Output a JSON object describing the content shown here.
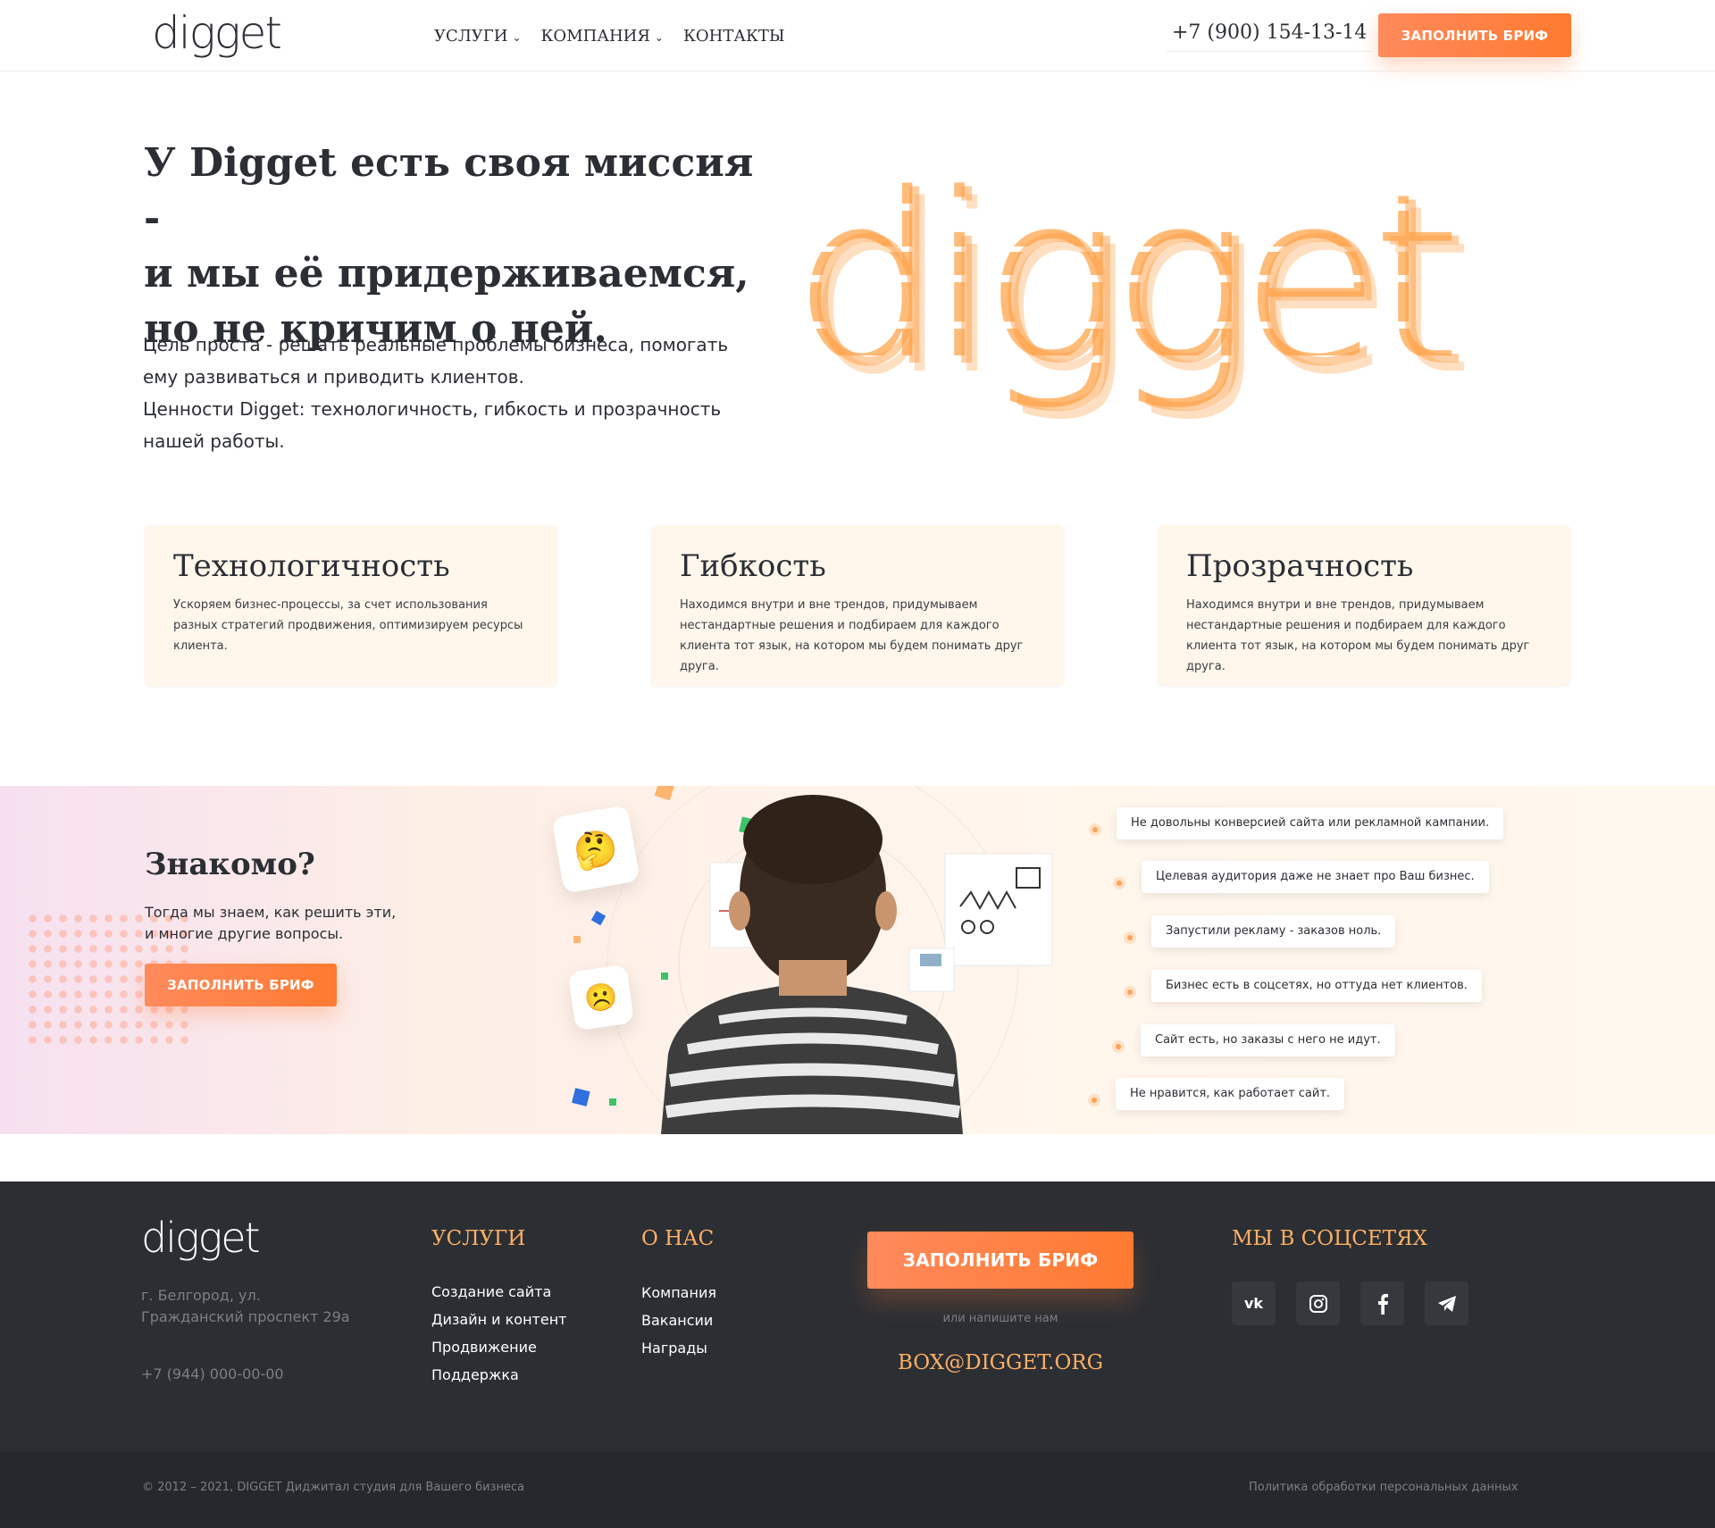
{
  "header": {
    "logo": "digget",
    "nav": [
      {
        "label": "УСЛУГИ",
        "has_dropdown": true
      },
      {
        "label": "КОМПАНИЯ",
        "has_dropdown": true
      },
      {
        "label": "КОНТАКТЫ",
        "has_dropdown": false
      }
    ],
    "phone": "+7 (900) 154-13-14",
    "cta": "ЗАПОЛНИТЬ БРИФ"
  },
  "hero": {
    "title_lines": [
      "У Digget есть своя миссия -",
      "и мы её придерживаемся,",
      "но не кричим о ней."
    ],
    "text_lines": [
      "Цель проста - решать реальные проблемы бизнеса, помогать",
      "ему развиваться и приводить клиентов.",
      "Ценности Digget: технологичность, гибкость и прозрачность",
      "нашей работы."
    ],
    "big_logo_text": "digget"
  },
  "values": [
    {
      "title": "Технологичность",
      "text": "Ускоряем бизнес-процессы, за счет использования разных стратегий продвижения, оптимизируем ресурсы клиента."
    },
    {
      "title": "Гибкость",
      "text": "Находимся внутри и вне трендов, придумываем нестандартные решения  и подбираем для каждого клиента тот язык, на котором мы будем понимать друг друга."
    },
    {
      "title": "Прозрачность",
      "text": "Находимся внутри и вне трендов, придумываем нестандартные решения  и подбираем для каждого клиента тот язык, на котором мы будем понимать друг друга."
    }
  ],
  "familiar": {
    "title": "Знакомо?",
    "text_lines": [
      "Тогда мы знаем, как решить эти,",
      "и многие другие вопросы."
    ],
    "cta": "ЗАПОЛНИТЬ БРИФ",
    "emojis": [
      "🤔",
      "☹️"
    ],
    "pains": [
      "Не довольны конверсией сайта или рекламной кампании.",
      "Целевая аудитория даже не знает про Ваш бизнес.",
      "Запустили рекламу - заказов ноль.",
      "Бизнес есть в соцсетях, но оттуда нет клиентов.",
      "Сайт есть, но заказы с него не идут.",
      "Не нравится, как работает сайт."
    ]
  },
  "footer": {
    "logo": "digget",
    "address": "г. Белгород, ул. Гражданский проспект 29а",
    "phone": "+7 (944) 000-00-00",
    "services_title": "УСЛУГИ",
    "services": [
      "Создание сайта",
      "Дизайн и контент",
      "Продвижение",
      "Поддержка"
    ],
    "about_title": "О НАС",
    "about": [
      "Компания",
      "Вакансии",
      "Награды"
    ],
    "cta": "ЗАПОЛНИТЬ БРИФ",
    "or_write": "или напишите нам",
    "email": "BOX@DIGGET.ORG",
    "social_title": "МЫ В СОЦСЕТЯХ",
    "socials": [
      "vk-icon",
      "instagram-icon",
      "facebook-icon",
      "telegram-icon"
    ],
    "copyright": "© 2012 – 2021, DIGGET Диджитал студия для Вашего бизнеса",
    "policy": "Политика обработки персональных данных"
  },
  "colors": {
    "accent": "#ff7a30",
    "accent_light": "#ffb066",
    "footer_bg": "#2b2e33",
    "card_bg": "#fff6ec"
  }
}
